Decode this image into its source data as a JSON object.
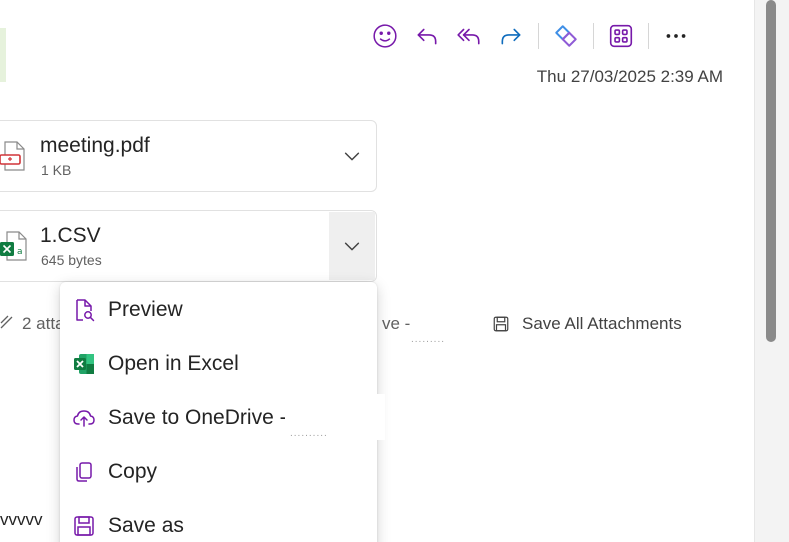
{
  "colors": {
    "accent": "#7719aa",
    "excel_green": "#107c41",
    "pdf_red": "#d13438"
  },
  "toolbar": {
    "items": [
      {
        "icon": "emoji-icon"
      },
      {
        "icon": "reply-icon"
      },
      {
        "icon": "reply-all-icon"
      },
      {
        "icon": "forward-icon"
      },
      {
        "icon": "copilot-icon"
      },
      {
        "icon": "apps-icon"
      },
      {
        "icon": "more-icon",
        "label": "···"
      }
    ]
  },
  "message": {
    "date": "Thu 27/03/2025 2:39 AM"
  },
  "attachments": [
    {
      "name": "meeting.pdf",
      "size": "1 KB",
      "icon": "pdf-file-icon"
    },
    {
      "name": "1.CSV",
      "size": "645 bytes",
      "icon": "excel-file-icon"
    }
  ],
  "attachment_bar": {
    "count_text": "2 atta",
    "save_partial": "ve -",
    "save_all_label": "Save All Attachments"
  },
  "body_text": "vvvvv",
  "context_menu": {
    "items": [
      {
        "label": "Preview",
        "icon": "preview-icon"
      },
      {
        "label": "Open in Excel",
        "icon": "excel-icon"
      },
      {
        "label": "Save to OneDrive -",
        "icon": "cloud-upload-icon"
      },
      {
        "label": "Copy",
        "icon": "copy-icon"
      },
      {
        "label": "Save as",
        "icon": "save-icon"
      }
    ]
  }
}
